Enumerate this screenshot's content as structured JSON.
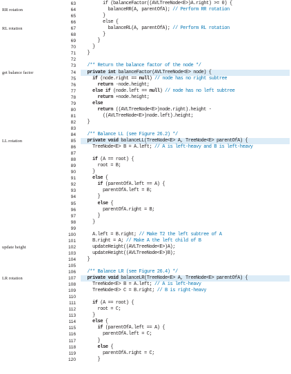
{
  "listing": {
    "highlight_color": "#dcecf7",
    "comment_color": "#0a78b4",
    "text_color": "#231f20",
    "lines": [
      {
        "n": "63",
        "annot": "",
        "hl": false,
        "tokens": [
          [
            "pl",
            "        if (balanceFactor((AVLTreeNode<E>)A.right) >= "
          ],
          [
            "pl",
            "0"
          ],
          [
            "pl",
            ") {"
          ]
        ]
      },
      {
        "n": "64",
        "annot": "RR rotation",
        "hl": false,
        "tokens": [
          [
            "pl",
            "          balanceRR(A, parentOfA); "
          ],
          [
            "cm",
            "// Perform RR rotation"
          ]
        ]
      },
      {
        "n": "65",
        "annot": "",
        "hl": false,
        "tokens": [
          [
            "pl",
            "        }"
          ]
        ]
      },
      {
        "n": "66",
        "annot": "",
        "hl": false,
        "tokens": [
          [
            "pl",
            "        else {"
          ]
        ]
      },
      {
        "n": "67",
        "annot": "RL rotation",
        "hl": false,
        "tokens": [
          [
            "pl",
            "          balanceRL(A, parentOfA); "
          ],
          [
            "cm",
            "// Perform RL rotation"
          ]
        ]
      },
      {
        "n": "68",
        "annot": "",
        "hl": false,
        "tokens": [
          [
            "pl",
            "        }"
          ]
        ]
      },
      {
        "n": "69",
        "annot": "",
        "hl": false,
        "tokens": [
          [
            "pl",
            "      }"
          ]
        ]
      },
      {
        "n": "70",
        "annot": "",
        "hl": false,
        "tokens": [
          [
            "pl",
            "    }"
          ]
        ]
      },
      {
        "n": "71",
        "annot": "",
        "hl": false,
        "tokens": [
          [
            "pl",
            "  }"
          ]
        ]
      },
      {
        "n": "72",
        "annot": "",
        "hl": false,
        "tokens": []
      },
      {
        "n": "73",
        "annot": "",
        "hl": false,
        "tokens": [
          [
            "cm",
            "  /** Return the balance factor of the node */"
          ]
        ]
      },
      {
        "n": "74",
        "annot": "get balance factor",
        "hl": true,
        "tokens": [
          [
            "pl",
            "  "
          ],
          [
            "kw",
            "private int"
          ],
          [
            "pl",
            " balanceFactor(AVLTreeNode<E> node) {"
          ]
        ]
      },
      {
        "n": "75",
        "annot": "",
        "hl": false,
        "tokens": [
          [
            "pl",
            "    "
          ],
          [
            "kw",
            "if"
          ],
          [
            "pl",
            " (node.right == "
          ],
          [
            "kw",
            "null"
          ],
          [
            "pl",
            ") "
          ],
          [
            "cm",
            "// node has no right subtree"
          ]
        ]
      },
      {
        "n": "76",
        "annot": "",
        "hl": false,
        "tokens": [
          [
            "pl",
            "      "
          ],
          [
            "kw",
            "return"
          ],
          [
            "pl",
            " -node.height;"
          ]
        ]
      },
      {
        "n": "77",
        "annot": "",
        "hl": false,
        "tokens": [
          [
            "pl",
            "    "
          ],
          [
            "kw",
            "else if"
          ],
          [
            "pl",
            " (node.left == "
          ],
          [
            "kw",
            "null"
          ],
          [
            "pl",
            ") "
          ],
          [
            "cm",
            "// node has no left subtree"
          ]
        ]
      },
      {
        "n": "78",
        "annot": "",
        "hl": false,
        "tokens": [
          [
            "pl",
            "      "
          ],
          [
            "kw",
            "return"
          ],
          [
            "pl",
            " +node.height;"
          ]
        ]
      },
      {
        "n": "79",
        "annot": "",
        "hl": false,
        "tokens": [
          [
            "pl",
            "    "
          ],
          [
            "kw",
            "else"
          ]
        ]
      },
      {
        "n": "80",
        "annot": "",
        "hl": false,
        "tokens": [
          [
            "pl",
            "      "
          ],
          [
            "kw",
            "return"
          ],
          [
            "pl",
            " ((AVLTreeNode<E>)node.right).height -"
          ]
        ]
      },
      {
        "n": "81",
        "annot": "",
        "hl": false,
        "tokens": [
          [
            "pl",
            "        ((AVLTreeNode<E>)node.left).height;"
          ]
        ]
      },
      {
        "n": "82",
        "annot": "",
        "hl": false,
        "tokens": [
          [
            "pl",
            "  }"
          ]
        ]
      },
      {
        "n": "83",
        "annot": "",
        "hl": false,
        "tokens": []
      },
      {
        "n": "84",
        "annot": "",
        "hl": false,
        "tokens": [
          [
            "cm",
            "  /** Balance LL (see Figure 26.2) */"
          ]
        ]
      },
      {
        "n": "85",
        "annot": "LL rotation",
        "hl": true,
        "tokens": [
          [
            "pl",
            "  "
          ],
          [
            "kw",
            "private void"
          ],
          [
            "pl",
            " balanceLL(TreeNode<E> A, TreeNode<E> parentOfA) {"
          ]
        ]
      },
      {
        "n": "86",
        "annot": "",
        "hl": false,
        "tokens": [
          [
            "pl",
            "    TreeNode<E> B = A.left; "
          ],
          [
            "cm",
            "// A is left-heavy and B is left-heavy"
          ]
        ]
      },
      {
        "n": "87",
        "annot": "",
        "hl": false,
        "tokens": []
      },
      {
        "n": "88",
        "annot": "",
        "hl": false,
        "tokens": [
          [
            "pl",
            "    "
          ],
          [
            "kw",
            "if"
          ],
          [
            "pl",
            " (A == root) {"
          ]
        ]
      },
      {
        "n": "89",
        "annot": "",
        "hl": false,
        "tokens": [
          [
            "pl",
            "      root = B;"
          ]
        ]
      },
      {
        "n": "90",
        "annot": "",
        "hl": false,
        "tokens": [
          [
            "pl",
            "    }"
          ]
        ]
      },
      {
        "n": "91",
        "annot": "",
        "hl": false,
        "tokens": [
          [
            "pl",
            "    "
          ],
          [
            "kw",
            "else"
          ],
          [
            "pl",
            " {"
          ]
        ]
      },
      {
        "n": "92",
        "annot": "",
        "hl": false,
        "tokens": [
          [
            "pl",
            "      "
          ],
          [
            "kw",
            "if"
          ],
          [
            "pl",
            " (parentOfA.left == A) {"
          ]
        ]
      },
      {
        "n": "93",
        "annot": "",
        "hl": false,
        "tokens": [
          [
            "pl",
            "        parentOfA.left = B;"
          ]
        ]
      },
      {
        "n": "94",
        "annot": "",
        "hl": false,
        "tokens": [
          [
            "pl",
            "      }"
          ]
        ]
      },
      {
        "n": "95",
        "annot": "",
        "hl": false,
        "tokens": [
          [
            "pl",
            "      "
          ],
          [
            "kw",
            "else"
          ],
          [
            "pl",
            " {"
          ]
        ]
      },
      {
        "n": "96",
        "annot": "",
        "hl": false,
        "tokens": [
          [
            "pl",
            "        parentOfA.right = B;"
          ]
        ]
      },
      {
        "n": "97",
        "annot": "",
        "hl": false,
        "tokens": [
          [
            "pl",
            "      }"
          ]
        ]
      },
      {
        "n": "98",
        "annot": "",
        "hl": false,
        "tokens": [
          [
            "pl",
            "    }"
          ]
        ]
      },
      {
        "n": "99",
        "annot": "",
        "hl": false,
        "tokens": []
      },
      {
        "n": "100",
        "annot": "",
        "hl": false,
        "tokens": [
          [
            "pl",
            "    A.left = B.right; "
          ],
          [
            "cm",
            "// Make T2 the left subtree of A"
          ]
        ]
      },
      {
        "n": "101",
        "annot": "",
        "hl": false,
        "tokens": [
          [
            "pl",
            "    B.right = A; "
          ],
          [
            "cm",
            "// Make A the left child of B"
          ]
        ]
      },
      {
        "n": "102",
        "annot": "update height",
        "hl": false,
        "tokens": [
          [
            "pl",
            "    updateHeight((AVLTreeNode<E>)A);"
          ]
        ]
      },
      {
        "n": "103",
        "annot": "",
        "hl": false,
        "tokens": [
          [
            "pl",
            "    updateHeight((AVLTreeNode<E>)B);"
          ]
        ]
      },
      {
        "n": "104",
        "annot": "",
        "hl": false,
        "tokens": [
          [
            "pl",
            "  }"
          ]
        ]
      },
      {
        "n": "105",
        "annot": "",
        "hl": false,
        "tokens": []
      },
      {
        "n": "106",
        "annot": "",
        "hl": false,
        "tokens": [
          [
            "cm",
            "  /** Balance LR (see Figure 26.4) */"
          ]
        ]
      },
      {
        "n": "107",
        "annot": "LR rotation",
        "hl": true,
        "tokens": [
          [
            "pl",
            "  "
          ],
          [
            "kw",
            "private void"
          ],
          [
            "pl",
            " balanceLR(TreeNode<E> A, TreeNode<E> parentOfA) {"
          ]
        ]
      },
      {
        "n": "108",
        "annot": "",
        "hl": false,
        "tokens": [
          [
            "pl",
            "    TreeNode<E> B = A.left; "
          ],
          [
            "cm",
            "// A is left-heavy"
          ]
        ]
      },
      {
        "n": "109",
        "annot": "",
        "hl": false,
        "tokens": [
          [
            "pl",
            "    TreeNode<E> C = B.right; "
          ],
          [
            "cm",
            "// B is right-heavy"
          ]
        ]
      },
      {
        "n": "110",
        "annot": "",
        "hl": false,
        "tokens": []
      },
      {
        "n": "111",
        "annot": "",
        "hl": false,
        "tokens": [
          [
            "pl",
            "    "
          ],
          [
            "kw",
            "if"
          ],
          [
            "pl",
            " (A == root) {"
          ]
        ]
      },
      {
        "n": "112",
        "annot": "",
        "hl": false,
        "tokens": [
          [
            "pl",
            "      root = C;"
          ]
        ]
      },
      {
        "n": "113",
        "annot": "",
        "hl": false,
        "tokens": [
          [
            "pl",
            "    }"
          ]
        ]
      },
      {
        "n": "114",
        "annot": "",
        "hl": false,
        "tokens": [
          [
            "pl",
            "    "
          ],
          [
            "kw",
            "else"
          ],
          [
            "pl",
            " {"
          ]
        ]
      },
      {
        "n": "115",
        "annot": "",
        "hl": false,
        "tokens": [
          [
            "pl",
            "      "
          ],
          [
            "kw",
            "if"
          ],
          [
            "pl",
            " (parentOfA.left == A) {"
          ]
        ]
      },
      {
        "n": "116",
        "annot": "",
        "hl": false,
        "tokens": [
          [
            "pl",
            "        parentOfA.left = C;"
          ]
        ]
      },
      {
        "n": "117",
        "annot": "",
        "hl": false,
        "tokens": [
          [
            "pl",
            "      }"
          ]
        ]
      },
      {
        "n": "118",
        "annot": "",
        "hl": false,
        "tokens": [
          [
            "pl",
            "      "
          ],
          [
            "kw",
            "else"
          ],
          [
            "pl",
            " {"
          ]
        ]
      },
      {
        "n": "119",
        "annot": "",
        "hl": false,
        "tokens": [
          [
            "pl",
            "        parentOfA.right = C;"
          ]
        ]
      },
      {
        "n": "120",
        "annot": "",
        "hl": false,
        "tokens": [
          [
            "pl",
            "      }"
          ]
        ]
      }
    ]
  }
}
